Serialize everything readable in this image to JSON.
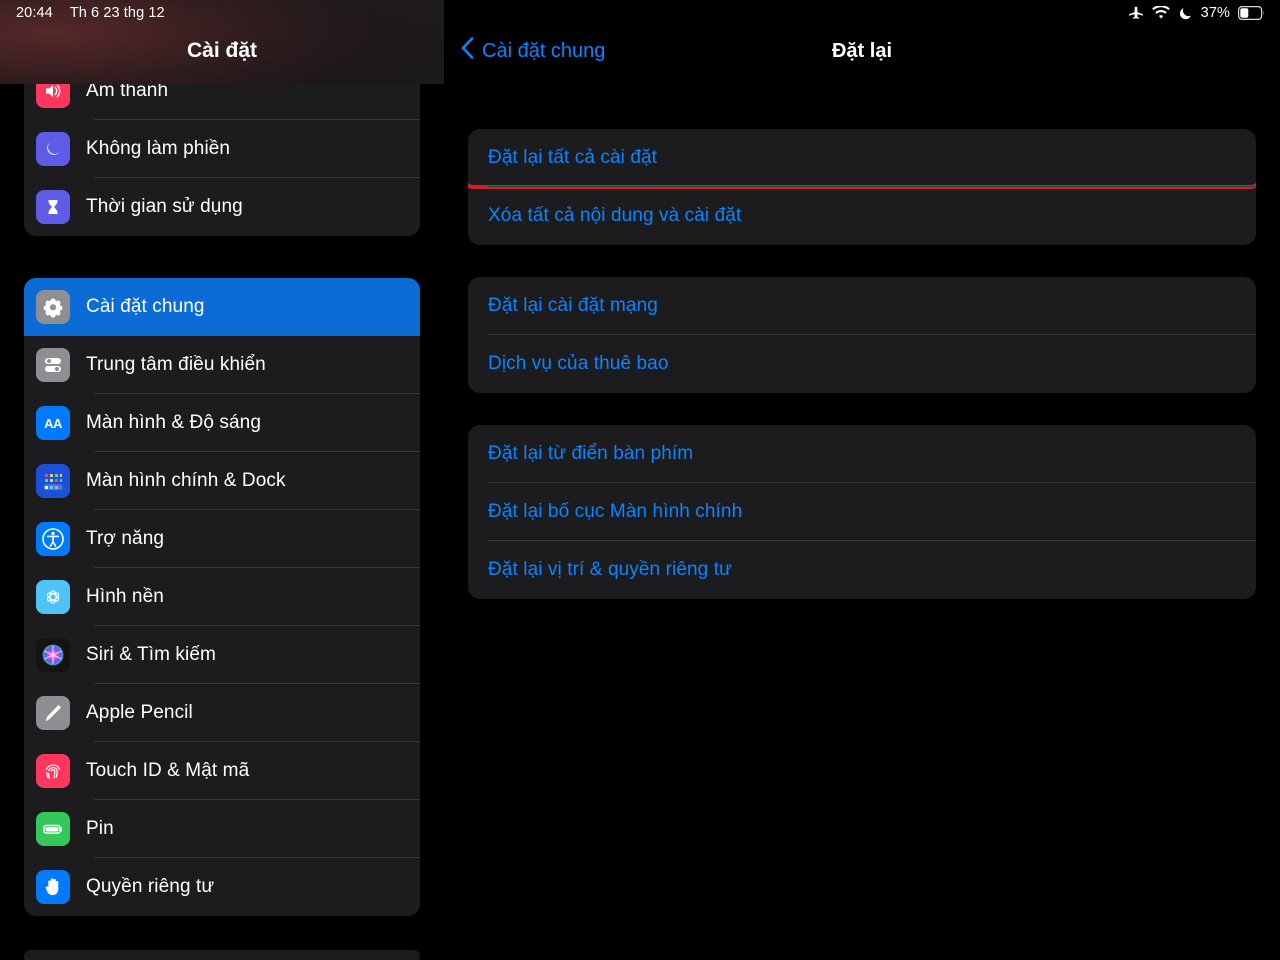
{
  "statusbar": {
    "time": "20:44",
    "date": "Th 6 23 thg 12",
    "battery_percent": "37%",
    "icons": [
      "airplane-mode-icon",
      "wifi-icon",
      "do-not-disturb-moon-icon",
      "battery-icon"
    ]
  },
  "sidebar": {
    "title": "Cài đặt",
    "group_top": [
      {
        "label": "Âm thanh",
        "icon": "sound-icon"
      },
      {
        "label": "Không làm phiền",
        "icon": "moon-icon"
      },
      {
        "label": "Thời gian sử dụng",
        "icon": "hourglass-icon"
      }
    ],
    "group_main": [
      {
        "label": "Cài đặt chung",
        "icon": "gear-icon",
        "selected": true
      },
      {
        "label": "Trung tâm điều khiển",
        "icon": "control-center-icon",
        "selected": false
      },
      {
        "label": "Màn hình & Độ sáng",
        "icon": "display-brightness-icon",
        "selected": false
      },
      {
        "label": "Màn hình chính & Dock",
        "icon": "home-screen-dock-icon",
        "selected": false
      },
      {
        "label": "Trợ năng",
        "icon": "accessibility-icon",
        "selected": false
      },
      {
        "label": "Hình nền",
        "icon": "wallpaper-icon",
        "selected": false
      },
      {
        "label": "Siri & Tìm kiếm",
        "icon": "siri-icon",
        "selected": false
      },
      {
        "label": "Apple Pencil",
        "icon": "apple-pencil-icon",
        "selected": false
      },
      {
        "label": "Touch ID & Mật mã",
        "icon": "touch-id-icon",
        "selected": false
      },
      {
        "label": "Pin",
        "icon": "battery-icon",
        "selected": false
      },
      {
        "label": "Quyền riêng tư",
        "icon": "privacy-hand-icon",
        "selected": false
      }
    ]
  },
  "detail": {
    "back_label": "Cài đặt chung",
    "title": "Đặt lại",
    "highlight_color": "#cc2127",
    "accent_color": "#0a84ff",
    "groups": [
      {
        "rows": [
          {
            "label": "Đặt lại tất cả cài đặt",
            "highlighted": true
          },
          {
            "label": "Xóa tất cả nội dung và cài đặt",
            "highlighted": false
          }
        ]
      },
      {
        "rows": [
          {
            "label": "Đặt lại cài đặt mạng",
            "highlighted": false
          },
          {
            "label": "Dịch vụ của thuê bao",
            "highlighted": false
          }
        ]
      },
      {
        "rows": [
          {
            "label": "Đặt lại từ điển bàn phím",
            "highlighted": false
          },
          {
            "label": "Đặt lại bố cục Màn hình chính",
            "highlighted": false
          },
          {
            "label": "Đặt lại vị trí & quyền riêng tư",
            "highlighted": false
          }
        ]
      }
    ]
  }
}
